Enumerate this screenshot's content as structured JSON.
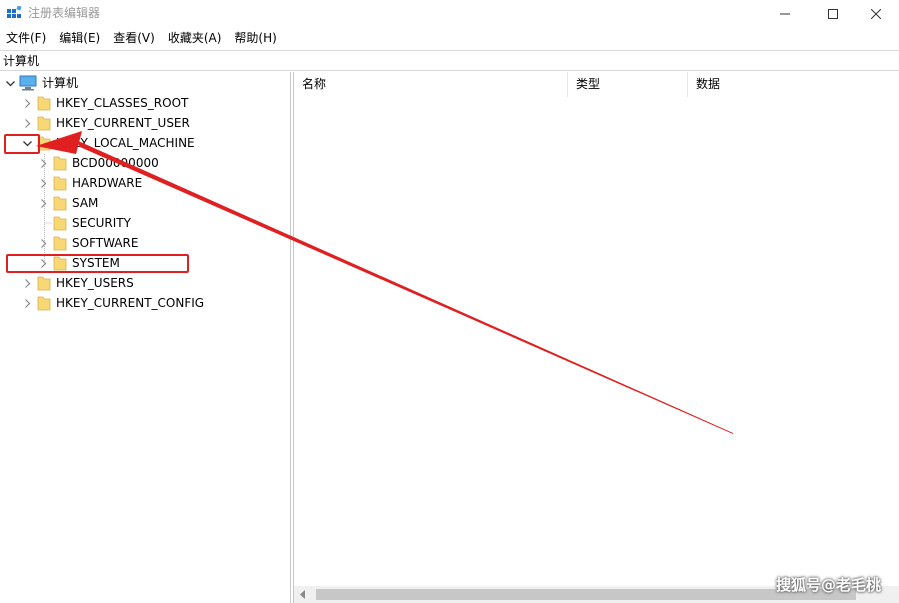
{
  "window": {
    "title": "注册表编辑器"
  },
  "menu": [
    {
      "label": "文件(F)"
    },
    {
      "label": "编辑(E)"
    },
    {
      "label": "查看(V)"
    },
    {
      "label": "收藏夹(A)"
    },
    {
      "label": "帮助(H)"
    }
  ],
  "address": {
    "path": "计算机"
  },
  "tree": {
    "root": "计算机",
    "hives": {
      "classes_root": "HKEY_CLASSES_ROOT",
      "current_user": "HKEY_CURRENT_USER",
      "local_machine": "HKEY_LOCAL_MACHINE",
      "users": "HKEY_USERS",
      "current_config": "HKEY_CURRENT_CONFIG"
    },
    "local_machine_children": {
      "bcd": "BCD00000000",
      "hardware": "HARDWARE",
      "sam": "SAM",
      "security": "SECURITY",
      "software": "SOFTWARE",
      "system": "SYSTEM"
    }
  },
  "list": {
    "columns": {
      "name": "名称",
      "type": "类型",
      "data": "数据"
    }
  },
  "watermark": "搜狐号@老毛桃",
  "colors": {
    "annotation_red": "#e02020",
    "folder_yellow": "#f8d775",
    "title_gray": "#999999"
  }
}
